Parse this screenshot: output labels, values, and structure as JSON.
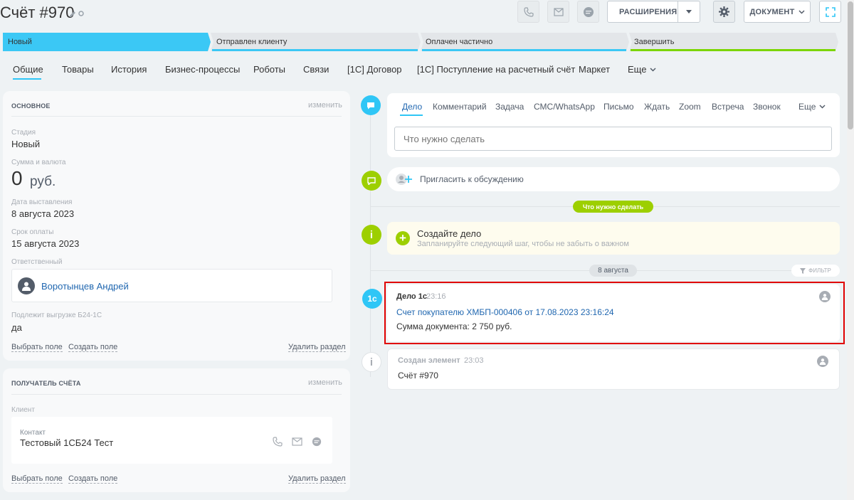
{
  "header": {
    "title": "Счёт #970",
    "extensions_label": "РАСШИРЕНИЯ",
    "document_label": "ДОКУМЕНТ"
  },
  "stages": [
    {
      "label": "Новый",
      "color": "#3bc8f5"
    },
    {
      "label": "Отправлен клиенту",
      "color": "#3bc8f5"
    },
    {
      "label": "Оплачен частично",
      "color": "#3bc8f5"
    },
    {
      "label": "Завершить",
      "color": "#7bd500"
    }
  ],
  "tabs": [
    "Общие",
    "Товары",
    "История",
    "Бизнес-процессы",
    "Роботы",
    "Связи",
    "[1С] Договор",
    "[1С] Поступление на расчетный счёт",
    "Маркет",
    "Еще"
  ],
  "main_panel": {
    "heading": "ОСНОВНОЕ",
    "change": "изменить",
    "stage_label": "Стадия",
    "stage_value": "Новый",
    "sum_label": "Сумма и валюта",
    "sum_value": "0",
    "sum_currency": "руб.",
    "date_label": "Дата выставления",
    "date_value": "8 августа 2023",
    "due_label": "Срок оплаты",
    "due_value": "15 августа 2023",
    "resp_label": "Ответственный",
    "resp_value": "Воротынцев Андрей",
    "export_label": "Подлежит выгрузке Б24-1С",
    "export_value": "да",
    "select_field": "Выбрать поле",
    "create_field": "Создать поле",
    "delete_section": "Удалить раздел"
  },
  "recipient_panel": {
    "heading": "ПОЛУЧАТЕЛЬ СЧЁТА",
    "change": "изменить",
    "client_label": "Клиент",
    "contact_label": "Контакт",
    "contact_value": "Тестовый 1СБ24 Тест",
    "select_field": "Выбрать поле",
    "create_field": "Создать поле",
    "delete_section": "Удалить раздел"
  },
  "editor": {
    "tabs": [
      "Дело",
      "Комментарий",
      "Задача",
      "СМС/WhatsApp",
      "Письмо",
      "Ждать",
      "Zoom",
      "Встреча",
      "Звонок",
      "Еще"
    ],
    "placeholder": "Что нужно сделать"
  },
  "invite_label": "Пригласить к обсуждению",
  "todo_pill": "Что нужно сделать",
  "create_task": {
    "title": "Создайте дело",
    "subtitle": "Запланируйте следующий шаг, чтобы не забыть о важном"
  },
  "date_pill": "8 августа",
  "filter_label": "ФИЛЬТР",
  "activity": {
    "icon_text": "1с",
    "title": "Дело 1с",
    "time": "23:16",
    "link": "Счет покупателю ХМБП-000406 от 17.08.2023 23:16:24",
    "sum": "Сумма документа: 2 750 руб."
  },
  "created": {
    "title": "Создан элемент",
    "time": "23:03",
    "value": "Счёт #970"
  },
  "colors": {
    "accent": "#2fc6f6",
    "link": "#2067b0",
    "green": "#9dcf00",
    "highlight": "#e00000"
  }
}
